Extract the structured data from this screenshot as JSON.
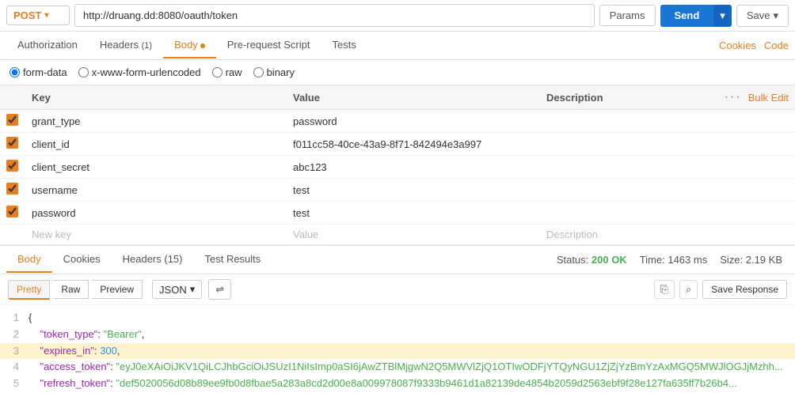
{
  "topbar": {
    "method": "POST",
    "url": "http://druang.dd:8080/oauth/token",
    "params_label": "Params",
    "send_label": "Send",
    "save_label": "Save"
  },
  "tabs": {
    "items": [
      {
        "id": "authorization",
        "label": "Authorization",
        "active": false,
        "badge": null,
        "dot": false
      },
      {
        "id": "headers",
        "label": "Headers",
        "active": false,
        "badge": "(1)",
        "dot": false
      },
      {
        "id": "body",
        "label": "Body",
        "active": true,
        "badge": null,
        "dot": true
      },
      {
        "id": "pre-request",
        "label": "Pre-request Script",
        "active": false,
        "badge": null,
        "dot": false
      },
      {
        "id": "tests",
        "label": "Tests",
        "active": false,
        "badge": null,
        "dot": false
      }
    ],
    "right": [
      "Cookies",
      "Code"
    ]
  },
  "body_options": {
    "options": [
      "form-data",
      "x-www-form-urlencoded",
      "raw",
      "binary"
    ],
    "selected": "form-data"
  },
  "table": {
    "headers": {
      "key": "Key",
      "value": "Value",
      "description": "Description",
      "bulk_edit": "Bulk Edit"
    },
    "rows": [
      {
        "checked": true,
        "key": "grant_type",
        "value": "password",
        "description": ""
      },
      {
        "checked": true,
        "key": "client_id",
        "value": "f011cc58-40ce-43a9-8f71-842494e3a997",
        "description": ""
      },
      {
        "checked": true,
        "key": "client_secret",
        "value": "abc123",
        "description": ""
      },
      {
        "checked": true,
        "key": "username",
        "value": "test",
        "description": ""
      },
      {
        "checked": true,
        "key": "password",
        "value": "test",
        "description": ""
      }
    ],
    "new_row": {
      "key": "New key",
      "value": "Value",
      "description": "Description"
    }
  },
  "response": {
    "tabs": [
      "Body",
      "Cookies",
      "Headers (15)",
      "Test Results"
    ],
    "active_tab": "Body",
    "status": {
      "label": "Status:",
      "value": "200 OK",
      "time_label": "Time:",
      "time_value": "1463 ms",
      "size_label": "Size:",
      "size_value": "2.19 KB"
    },
    "view_buttons": [
      "Pretty",
      "Raw",
      "Preview"
    ],
    "active_view": "Pretty",
    "format": "JSON",
    "save_response_label": "Save Response",
    "code_lines": [
      {
        "num": 1,
        "content": "{",
        "type": "brace"
      },
      {
        "num": 2,
        "content": "    \"token_type\": \"Bearer\",",
        "type": "key-str"
      },
      {
        "num": 3,
        "content": "    \"expires_in\": 300,",
        "type": "key-num",
        "highlight": true
      },
      {
        "num": 4,
        "content": "    \"access_token\": \"eyJ0eXAiOiJKV1QiLCJhbGciOiJSUzI1NiIsImp0aSI6jAwZTBlMjgwN2Q5MWVlZjQ1OTIwODFjYTQyNGU1ZjZjYzBmYzAxMGQ5MWJlOGJjMzhh",
        "type": "key-str"
      },
      {
        "num": 5,
        "content": "    \"refresh_token\": \"def5020056d08b89ee9fb0d8fbae5a283a8cd2d00e8a009978087f9333b9461d1a82139de4854b2059d2563ebf9f28e127fa635ff7b26b4",
        "type": "key-str"
      }
    ]
  }
}
